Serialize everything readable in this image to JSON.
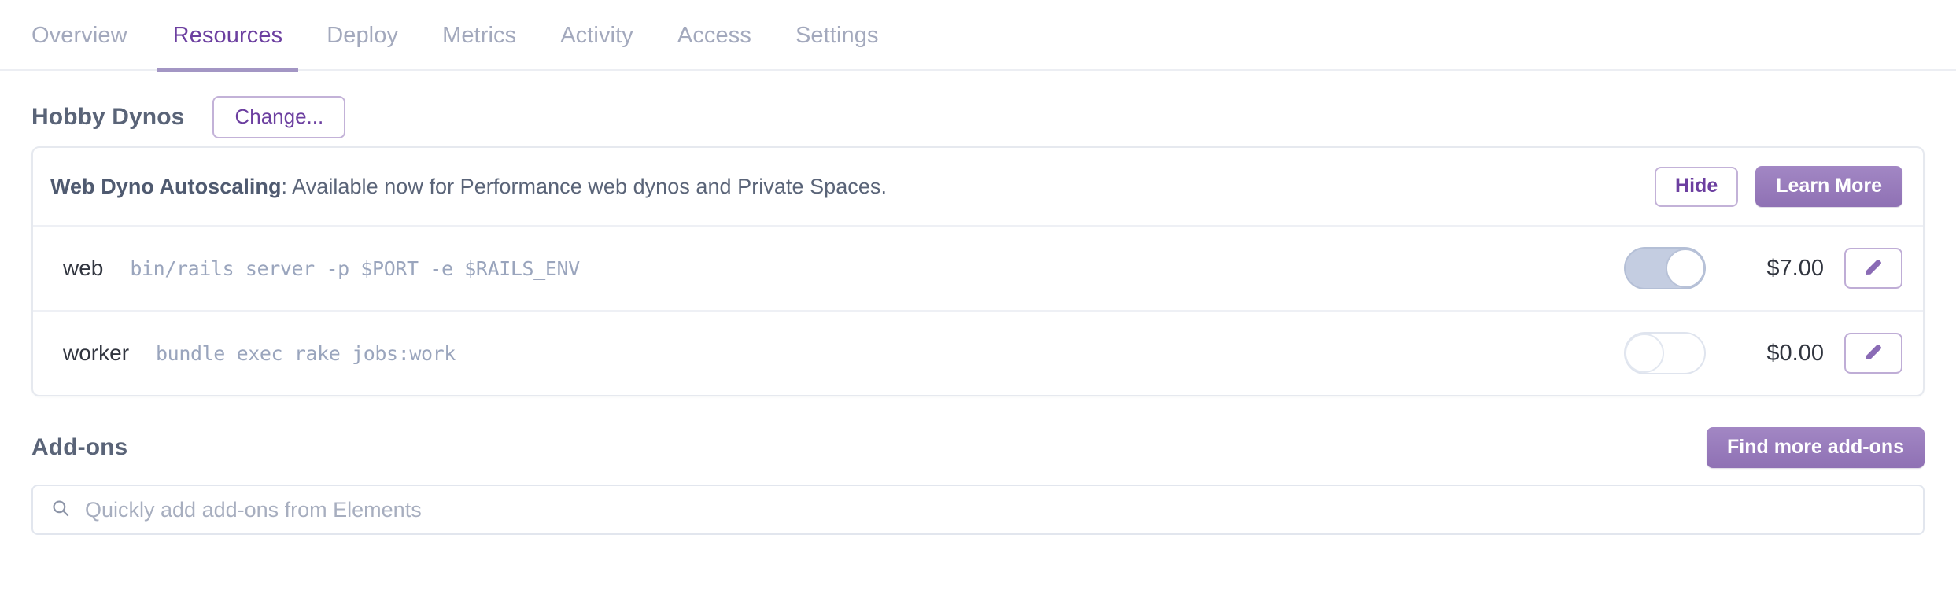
{
  "tabs": [
    {
      "label": "Overview",
      "active": false
    },
    {
      "label": "Resources",
      "active": true
    },
    {
      "label": "Deploy",
      "active": false
    },
    {
      "label": "Metrics",
      "active": false
    },
    {
      "label": "Activity",
      "active": false
    },
    {
      "label": "Access",
      "active": false
    },
    {
      "label": "Settings",
      "active": false
    }
  ],
  "dynos_section": {
    "title": "Hobby Dynos",
    "change_label": "Change...",
    "banner": {
      "strong": "Web Dyno Autoscaling",
      "rest": ": Available now for Performance web dynos and Private Spaces.",
      "hide_label": "Hide",
      "learn_more_label": "Learn More"
    },
    "rows": [
      {
        "name": "web",
        "command": "bin/rails server -p $PORT -e $RAILS_ENV",
        "toggle_state": "on",
        "price": "$7.00",
        "edit_icon": "pencil-icon"
      },
      {
        "name": "worker",
        "command": "bundle exec rake jobs:work",
        "toggle_state": "off",
        "price": "$0.00",
        "edit_icon": "pencil-icon"
      }
    ]
  },
  "addons_section": {
    "title": "Add-ons",
    "find_more_label": "Find more add-ons",
    "search": {
      "icon": "search-icon",
      "placeholder": "Quickly add add-ons from Elements",
      "value": ""
    }
  },
  "colors": {
    "accent_purple": "#6c3fa0",
    "button_purple": "#8f71b4",
    "heading_slate": "#5a6478",
    "muted_text": "#a3a9bd",
    "toggle_on": "#c4cde1"
  }
}
